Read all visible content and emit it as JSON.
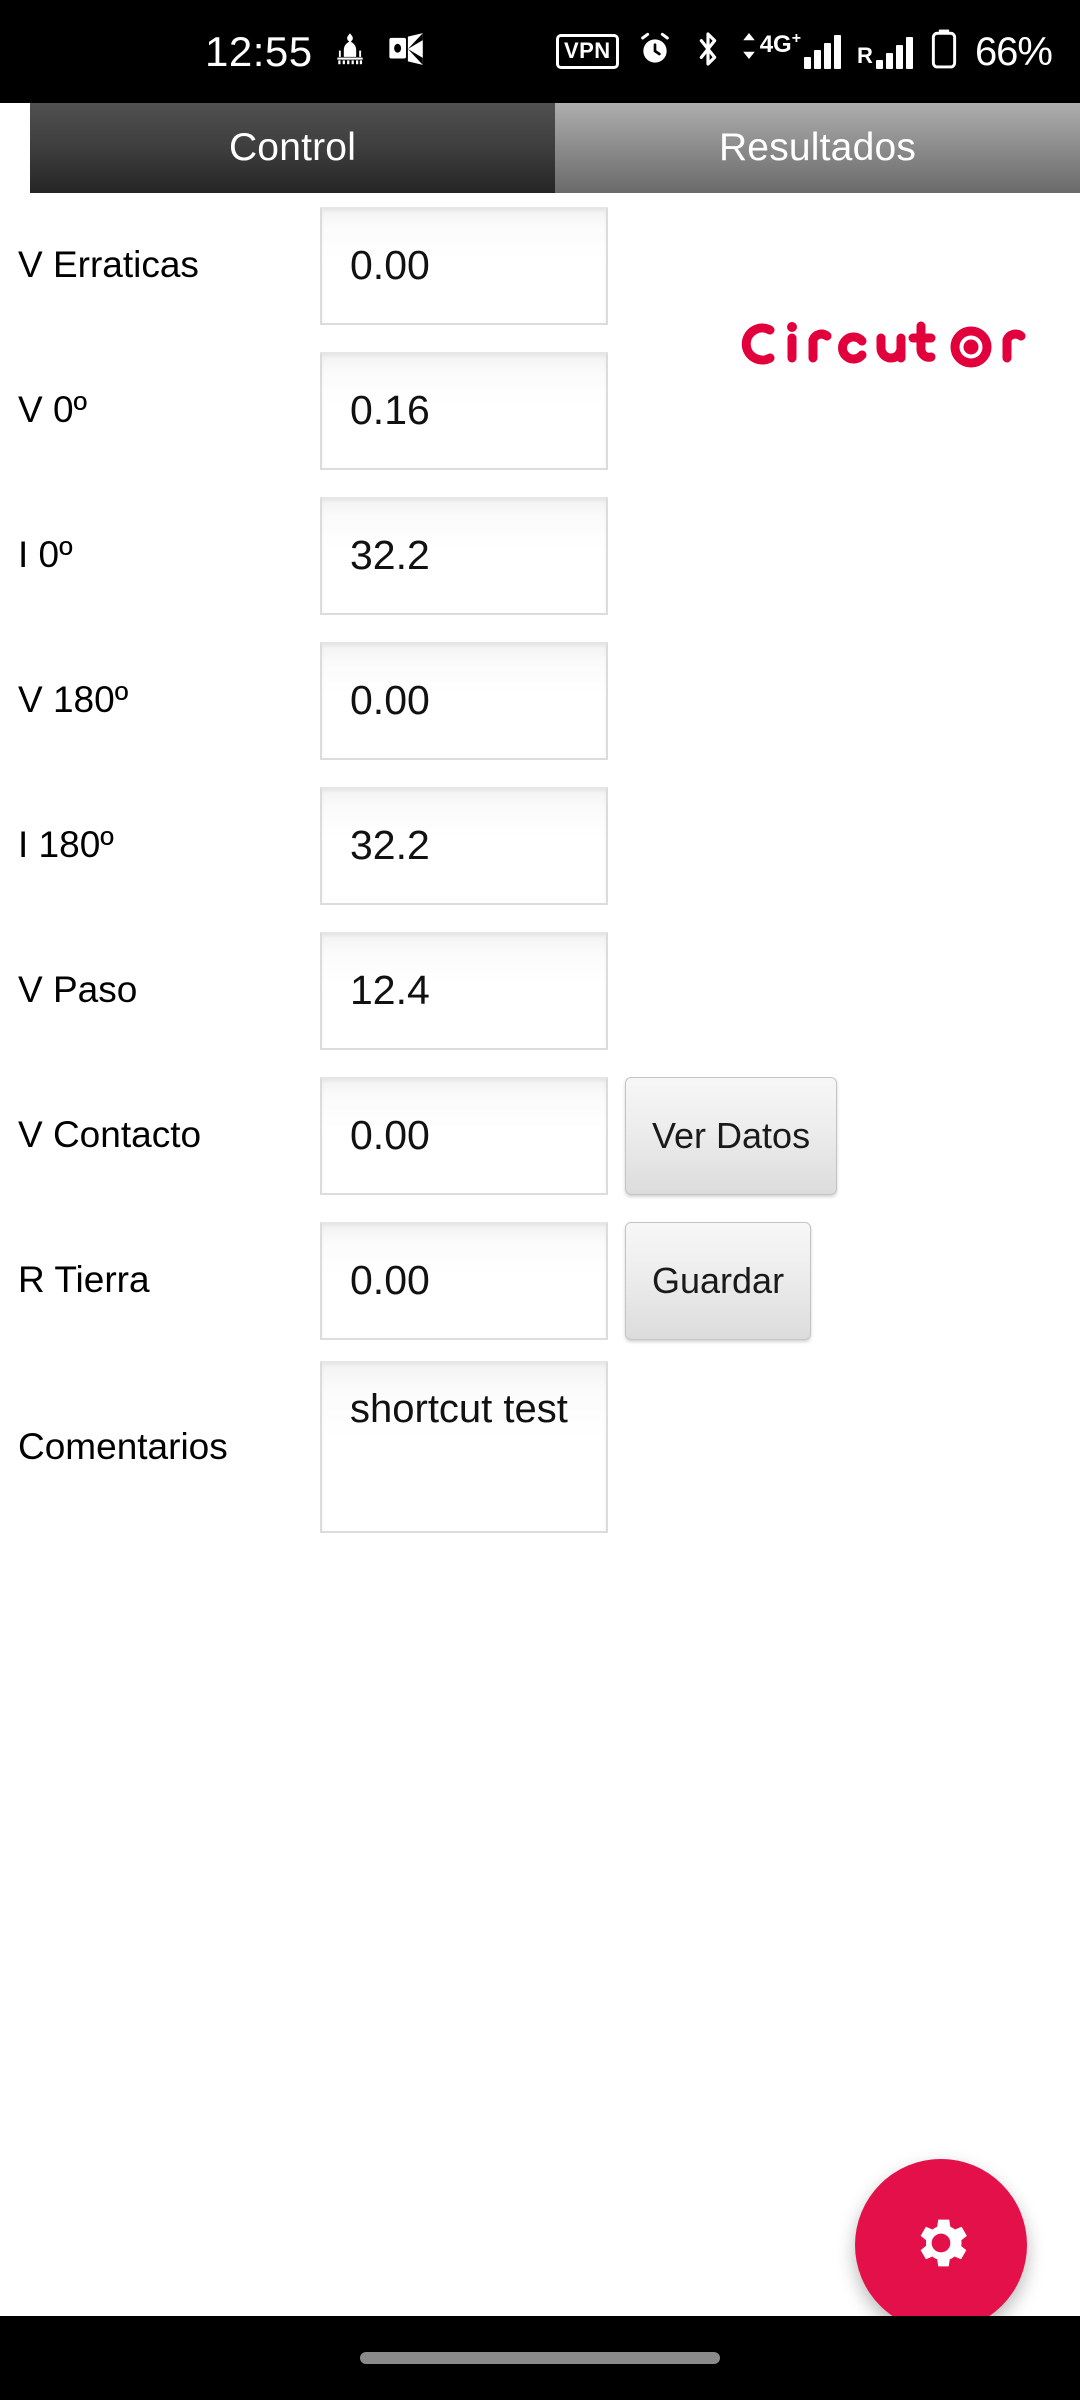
{
  "status_bar": {
    "time": "12:55",
    "left_icons": [
      {
        "name": "prayer-times-icon",
        "glyph": "mosque"
      },
      {
        "name": "outlook-icon",
        "glyph": "outlook"
      }
    ],
    "vpn_label": "VPN",
    "right_icons": [
      {
        "name": "alarm-clock-icon"
      },
      {
        "name": "bluetooth-icon"
      }
    ],
    "network_type": "4G",
    "network_plus": "+",
    "roaming_label": "R",
    "battery_percent": "66%"
  },
  "tabs": [
    {
      "label": "Control",
      "active": true
    },
    {
      "label": "Resultados",
      "active": false
    }
  ],
  "brand": {
    "name": "Circutor",
    "color": "#E2003C"
  },
  "accent_color": "#E3104A",
  "form": {
    "rows": [
      {
        "label": "V Erraticas",
        "value": "0.00",
        "button": null
      },
      {
        "label": "V 0º",
        "value": "0.16",
        "button": null
      },
      {
        "label": "I 0º",
        "value": "32.2",
        "button": null
      },
      {
        "label": "V 180º",
        "value": "0.00",
        "button": null
      },
      {
        "label": "I 180º",
        "value": "32.2",
        "button": null
      },
      {
        "label": "V Paso",
        "value": "12.4",
        "button": null
      },
      {
        "label": "V Contacto",
        "value": "0.00",
        "button": "Ver Datos"
      },
      {
        "label": "R Tierra",
        "value": "0.00",
        "button": "Guardar"
      },
      {
        "label": "Comentarios",
        "value": "shortcut test",
        "button": null,
        "multiline": true
      }
    ]
  },
  "fab": {
    "icon": "gear-icon"
  }
}
